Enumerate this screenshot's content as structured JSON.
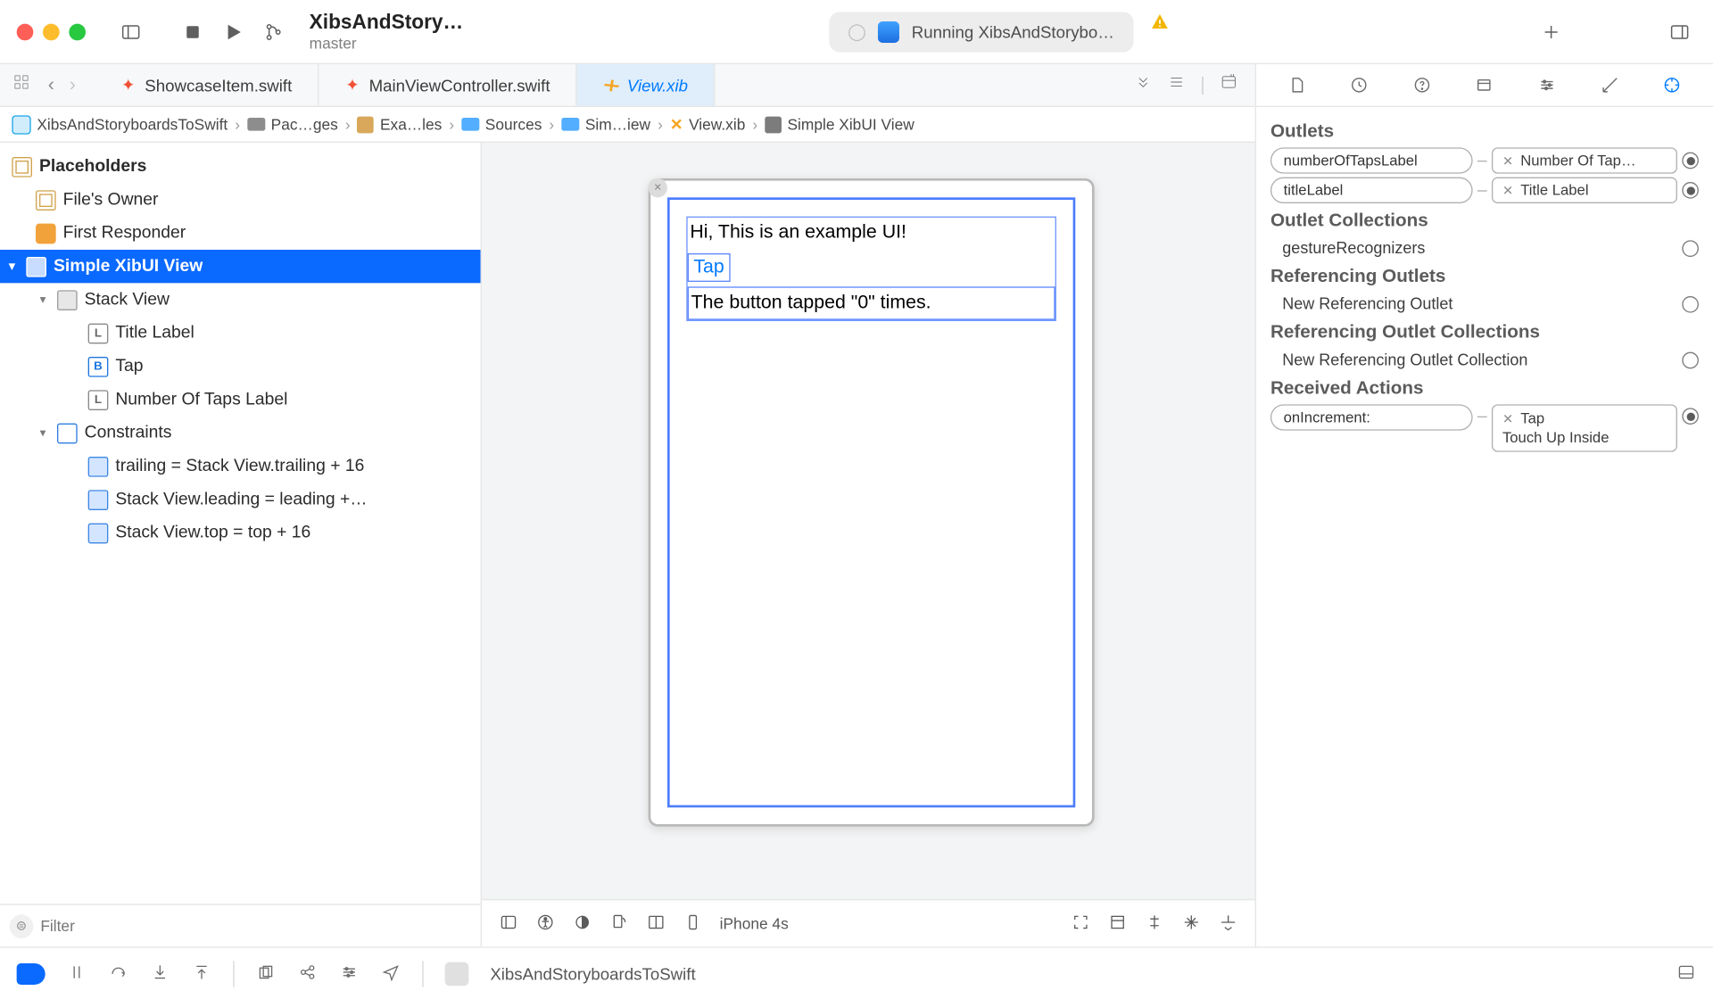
{
  "toolbar": {
    "project_title": "XibsAndStory…",
    "branch": "master",
    "activity": "Running XibsAndStorybo…"
  },
  "tabs": [
    {
      "label": "ShowcaseItem.swift",
      "kind": "swift",
      "active": false
    },
    {
      "label": "MainViewController.swift",
      "kind": "swift",
      "active": false
    },
    {
      "label": "View.xib",
      "kind": "xib",
      "active": true
    }
  ],
  "breadcrumb": [
    {
      "icon": "app",
      "label": "XibsAndStoryboardsToSwift"
    },
    {
      "icon": "folder",
      "label": "Pac…ges"
    },
    {
      "icon": "package",
      "label": "Exa…les"
    },
    {
      "icon": "folderb",
      "label": "Sources"
    },
    {
      "icon": "folderb",
      "label": "Sim…iew"
    },
    {
      "icon": "xib",
      "label": "View.xib"
    },
    {
      "icon": "view",
      "label": "Simple XibUI View"
    }
  ],
  "outline": {
    "placeholders_header": "Placeholders",
    "files_owner": "File's Owner",
    "first_responder": "First Responder",
    "root_view": "Simple XibUI View",
    "stack_view": "Stack View",
    "title_label": "Title Label",
    "tap_button": "Tap",
    "taps_label": "Number Of Taps Label",
    "constraints_header": "Constraints",
    "c1": "trailing = Stack View.trailing + 16",
    "c2": "Stack View.leading = leading +…",
    "c3": "Stack View.top = top + 16",
    "filter_placeholder": "Filter"
  },
  "canvas": {
    "title_text": "Hi, This is an example UI!",
    "button_text": "Tap",
    "count_text": "The button tapped \"0\" times.",
    "device": "iPhone 4s"
  },
  "inspector": {
    "outlets_header": "Outlets",
    "outlet1_name": "numberOfTapsLabel",
    "outlet1_dest": "Number Of Tap…",
    "outlet2_name": "titleLabel",
    "outlet2_dest": "Title Label",
    "outlet_collections_header": "Outlet Collections",
    "gesture_recognizers": "gestureRecognizers",
    "ref_outlets_header": "Referencing Outlets",
    "new_ref_outlet": "New Referencing Outlet",
    "ref_outlet_coll_header": "Referencing Outlet Collections",
    "new_ref_outlet_coll": "New Referencing Outlet Collection",
    "received_actions_header": "Received Actions",
    "action_name": "onIncrement:",
    "action_dest": "Tap",
    "action_event": "Touch Up Inside"
  },
  "debugbar": {
    "process": "XibsAndStoryboardsToSwift"
  }
}
